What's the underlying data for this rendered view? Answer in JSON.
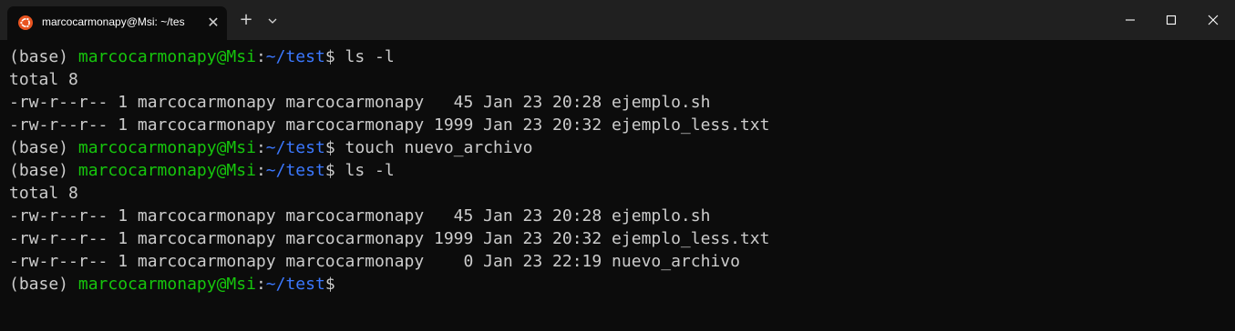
{
  "window": {
    "tab_title": "marcocarmonapy@Msi: ~/tes",
    "tab_close_glyph": "✕",
    "new_tab_glyph": "+",
    "accent_ubuntu": "#e95420"
  },
  "colors": {
    "background": "#0c0c0c",
    "titlebar": "#202020",
    "text": "#cccccc",
    "user": "#16c60c",
    "path": "#3b78ff"
  },
  "prompt": {
    "env": "(base) ",
    "user_host": "marcocarmonapy@Msi",
    "colon": ":",
    "path": "~/test",
    "dollar": "$ "
  },
  "lines": [
    {
      "type": "prompt",
      "command": "ls -l"
    },
    {
      "type": "output",
      "text": "total 8"
    },
    {
      "type": "output",
      "text": "-rw-r--r-- 1 marcocarmonapy marcocarmonapy   45 Jan 23 20:28 ejemplo.sh"
    },
    {
      "type": "output",
      "text": "-rw-r--r-- 1 marcocarmonapy marcocarmonapy 1999 Jan 23 20:32 ejemplo_less.txt"
    },
    {
      "type": "prompt",
      "command": "touch nuevo_archivo"
    },
    {
      "type": "prompt",
      "command": "ls -l"
    },
    {
      "type": "output",
      "text": "total 8"
    },
    {
      "type": "output",
      "text": "-rw-r--r-- 1 marcocarmonapy marcocarmonapy   45 Jan 23 20:28 ejemplo.sh"
    },
    {
      "type": "output",
      "text": "-rw-r--r-- 1 marcocarmonapy marcocarmonapy 1999 Jan 23 20:32 ejemplo_less.txt"
    },
    {
      "type": "output",
      "text": "-rw-r--r-- 1 marcocarmonapy marcocarmonapy    0 Jan 23 22:19 nuevo_archivo"
    },
    {
      "type": "prompt",
      "command": ""
    }
  ]
}
